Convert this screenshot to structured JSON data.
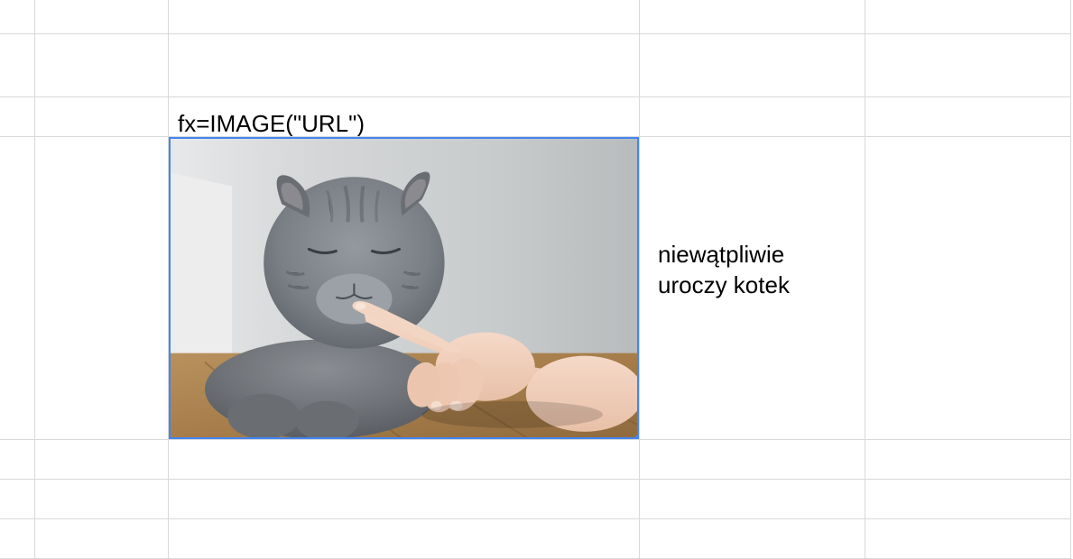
{
  "selection": {
    "color": "#4285f4"
  },
  "grid": {
    "border_color": "#d9d9d9"
  },
  "cells": {
    "formula_label": "fx=IMAGE(\"URL\")",
    "caption_line1": "niewątpliwie",
    "caption_line2": "uroczy kotek",
    "image_description": "gray-cat-being-petted"
  }
}
